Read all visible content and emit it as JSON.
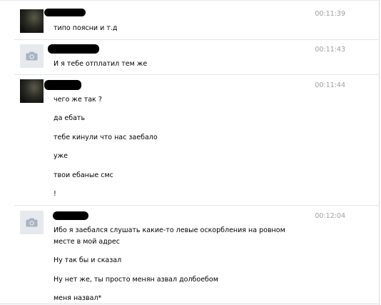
{
  "messages": [
    {
      "avatar": "photo-avatar",
      "time": "00:11:39",
      "lines": [
        "типо поясни и т.д"
      ]
    },
    {
      "avatar": "camera-icon",
      "time": "00:11:43",
      "lines": [
        "И я тебе отплатил тем же"
      ]
    },
    {
      "avatar": "photo-avatar",
      "time": "00:11:44",
      "lines": [
        "чего же так ?",
        "да ебать",
        "тебе кинули что нас заебало",
        "уже",
        "твои ебаные смс",
        "!"
      ]
    },
    {
      "avatar": "camera-icon",
      "time": "00:12:04",
      "lines": [
        "Ибо я заебался слушать какие-то левые оскорбления на ровном",
        "месте в мой адрес",
        "Ну так бы и сказал",
        "Ну нет же, ты просто менян азвал долбоебом",
        "меня назвал*"
      ]
    }
  ]
}
